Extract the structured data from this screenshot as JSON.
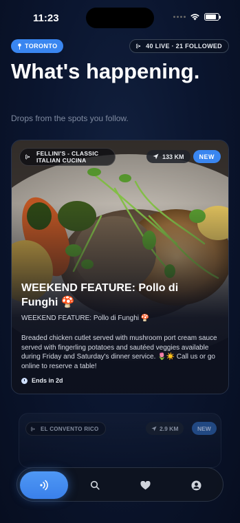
{
  "status_bar": {
    "time": "11:23"
  },
  "header": {
    "city": "TORONTO",
    "live_summary": "40 LIVE · 21 FOLLOWED",
    "title": "What's happening.",
    "subtitle": "Drops from the spots you follow."
  },
  "feed": [
    {
      "spot": "FELLINI'S - CLASSIC ITALIAN CUCINA",
      "distance": "133 KM",
      "badge": "NEW",
      "title": "WEEKEND FEATURE: Pollo di Funghi 🍄",
      "subtitle": "WEEKEND FEATURE: Pollo di Funghi 🍄",
      "description": "Breaded chicken cutlet served with mushroom port cream sauce served with fingerling potatoes and sautéed veggies available during Friday and Saturday's dinner service. 🌷☀️ Call us or go online to reserve a table!",
      "ends": "Ends in 2d"
    },
    {
      "spot": "EL CONVENTO RICO",
      "distance": "2.9 KM",
      "badge": "NEW"
    }
  ],
  "tabbar": {
    "icons": [
      "live-broadcast-icon",
      "search-icon",
      "heart-icon",
      "profile-icon"
    ]
  },
  "colors": {
    "accent": "#3a86f0",
    "background": "#0b1630"
  }
}
